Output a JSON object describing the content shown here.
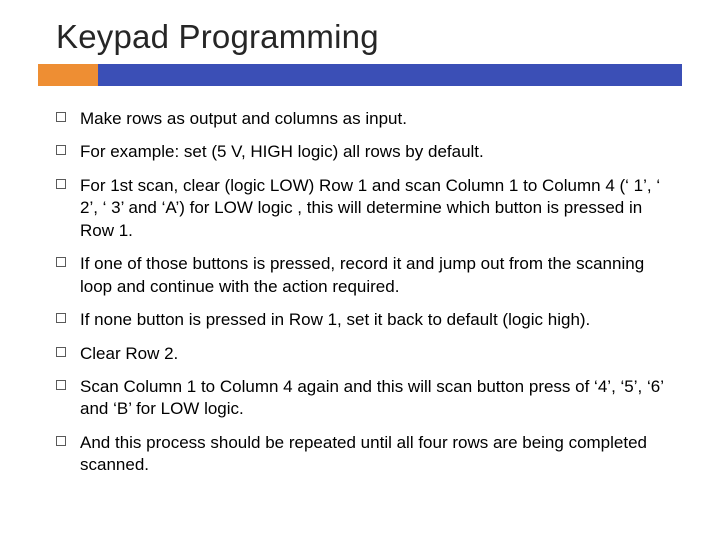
{
  "title": "Keypad Programming",
  "bullets": [
    "Make rows as output and columns as input.",
    "For example: set (5 V, HIGH logic) all rows by default.",
    "For 1st scan, clear (logic LOW) Row 1 and scan Column 1 to Column 4 (‘ 1’, ‘ 2’, ‘ 3’ and ‘A’) for LOW logic , this will determine which button is pressed in Row 1.",
    "If one of those buttons is pressed, record it and jump out from the scanning loop and continue with the action required.",
    "If none button is pressed in Row 1, set it back to default (logic high).",
    "Clear Row 2.",
    "Scan Column 1 to Column 4 again and this will scan button press of ‘4’, ‘5’, ‘6’ and ‘B’ for LOW logic.",
    "And this process should be repeated until all four rows are being completed scanned."
  ]
}
